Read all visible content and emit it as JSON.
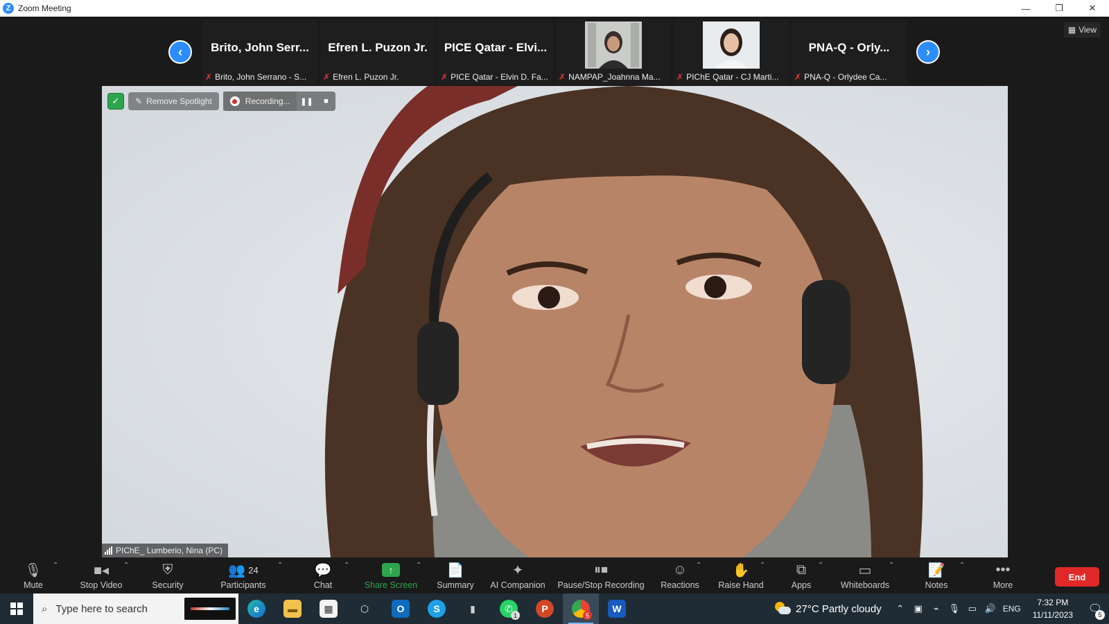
{
  "window": {
    "title": "Zoom Meeting",
    "logo": "Z",
    "controls": [
      "—",
      "❐",
      "✕"
    ]
  },
  "strip": {
    "tiles": [
      {
        "big": "Brito, John Serr...",
        "label": "Brito, John Serrano - S...",
        "kind": "name"
      },
      {
        "big": "Efren L. Puzon Jr.",
        "label": "Efren L. Puzon Jr.",
        "kind": "name"
      },
      {
        "big": "PICE Qatar - Elvi...",
        "label": "PICE Qatar - Elvin D. Fa...",
        "kind": "name"
      },
      {
        "big": "",
        "label": "NAMPAP_Joahnna Ma...",
        "kind": "video"
      },
      {
        "big": "",
        "label": "PIChE Qatar - CJ Marti...",
        "kind": "video"
      },
      {
        "big": "PNA-Q  -  Orly...",
        "label": "PNA-Q  -  Orlydee Ca...",
        "kind": "name"
      }
    ],
    "view_label": "View"
  },
  "video": {
    "remove_spotlight": "Remove Spotlight",
    "recording": "Recording...",
    "speaker": "PIChE_ Lumberio, Nina (PC)"
  },
  "toolbar": {
    "mute": "Mute",
    "stop_video": "Stop Video",
    "security": "Security",
    "participants": "Participants",
    "participants_count": "24",
    "chat": "Chat",
    "share_screen": "Share Screen",
    "summary": "Summary",
    "ai_companion": "AI Companion",
    "pause_stop_recording": "Pause/Stop Recording",
    "reactions": "Reactions",
    "raise_hand": "Raise Hand",
    "apps": "Apps",
    "whiteboards": "Whiteboards",
    "notes": "Notes",
    "more": "More",
    "end": "End"
  },
  "taskbar": {
    "search_placeholder": "Type here to search",
    "whatsapp_badge": "1",
    "chrome_badge": "5",
    "weather": "27°C  Partly cloudy",
    "lang": "ENG",
    "time": "7:32 PM",
    "date": "11/11/2023",
    "notif_count": "5"
  },
  "colors": {
    "accent": "#2d8cff",
    "green": "#2ea44f",
    "end": "#e02828"
  }
}
